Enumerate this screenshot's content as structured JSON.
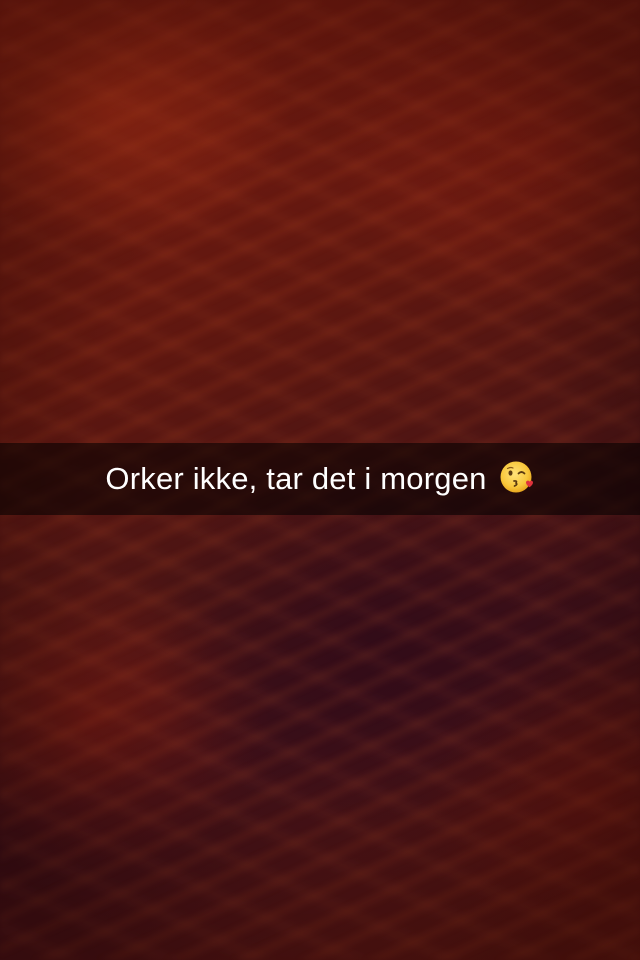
{
  "caption": {
    "text": "Orker ikke, tar det i morgen",
    "emoji": "face-throwing-a-kiss"
  },
  "colors": {
    "background_primary": "#5e1710",
    "caption_bar": "#000000",
    "caption_text": "#ffffff",
    "emoji_face": "#f8c83c",
    "emoji_heart": "#e0323c"
  }
}
